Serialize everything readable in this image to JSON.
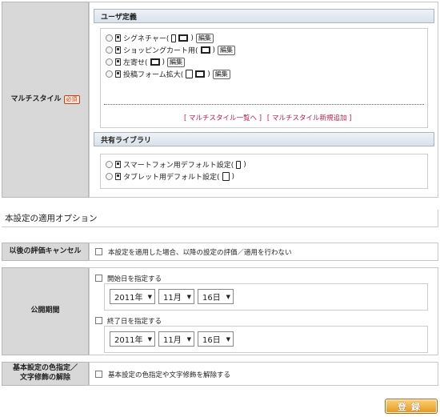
{
  "multistyle": {
    "label": "マルチスタイル",
    "required": "必須",
    "user_section": "ユーザ定義",
    "items": [
      {
        "name": "シグネチャー(",
        "edit": "編集"
      },
      {
        "name": "ショッピングカート用(",
        "edit": "編集"
      },
      {
        "name": "左寄せ(",
        "edit": "編集"
      },
      {
        "name": "投稿フォーム拡大(",
        "edit": "編集"
      }
    ],
    "close_paren": ")",
    "link_list": "[ マルチスタイル一覧へ ]",
    "link_add": "[ マルチスタイル新規追加 ]",
    "shared_section": "共有ライブラリ",
    "shared_items": [
      {
        "name": "スマートフォン用デフォルト設定("
      },
      {
        "name": "タブレット用デフォルト設定("
      }
    ]
  },
  "options": {
    "heading": "本設定の適用オプション",
    "cancel_label": "以後の評価キャンセル",
    "cancel_text": "本設定を適用した場合、以降の設定の評価／適用を行わない",
    "period_label": "公開期間",
    "start_check": "開始日を指定する",
    "end_check": "終了日を指定する",
    "start": {
      "year": "2011年",
      "month": "11月",
      "day": "16日"
    },
    "end": {
      "year": "2011年",
      "month": "11月",
      "day": "16日"
    },
    "color_label_1": "基本設定の色指定／",
    "color_label_2": "文字修飾の解除",
    "color_text": "基本設定の色指定や文字修飾を解除する"
  },
  "submit_label": "登録"
}
